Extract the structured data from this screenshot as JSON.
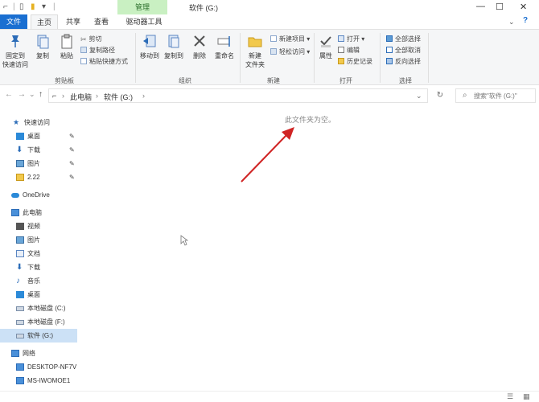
{
  "titlebar": {
    "context_tab": "管理",
    "title": "软件 (G:)",
    "minimize": "—",
    "maximize": "☐",
    "close": "✕"
  },
  "tabs": {
    "file": "文件",
    "home": "主页",
    "share": "共享",
    "view": "查看",
    "drive_tools": "驱动器工具"
  },
  "ribbon": {
    "clipboard": {
      "label": "剪贴板",
      "pin": "固定到\n快速访问",
      "copy": "复制",
      "paste": "粘贴",
      "cut": "剪切",
      "copy_path": "复制路径",
      "paste_shortcut": "粘贴快捷方式"
    },
    "organize": {
      "label": "组织",
      "move_to": "移动到",
      "copy_to": "复制到",
      "delete": "删除",
      "rename": "重命名"
    },
    "new": {
      "label": "新建",
      "new_folder": "新建\n文件夹",
      "new_item": "新建项目 ▾",
      "easy_access": "轻松访问 ▾"
    },
    "open": {
      "label": "打开",
      "properties": "属性",
      "open": "打开 ▾",
      "edit": "编辑",
      "history": "历史记录"
    },
    "select": {
      "label": "选择",
      "select_all": "全部选择",
      "select_none": "全部取消",
      "invert": "反向选择"
    }
  },
  "address": {
    "back": "←",
    "forward": "→",
    "recent": "⌄",
    "up": "↑",
    "crumb_pc": "此电脑",
    "crumb_sep": "›",
    "crumb_drive": "软件 (G:)",
    "dropdown": "⌄",
    "refresh": "↻",
    "search_placeholder": "搜索\"软件 (G:)\""
  },
  "nav": {
    "quick_access": "快速访问",
    "desktop": "桌面",
    "downloads": "下载",
    "pictures": "图片",
    "folder_222": "2.22",
    "onedrive": "OneDrive",
    "this_pc": "此电脑",
    "videos": "视频",
    "pictures2": "图片",
    "documents": "文档",
    "downloads2": "下载",
    "music": "音乐",
    "desktop2": "桌面",
    "local_c": "本地磁盘 (C:)",
    "local_f": "本地磁盘 (F:)",
    "software_g": "软件 (G:)",
    "network": "网络",
    "desktop_host": "DESKTOP-NF7V",
    "ms_host": "MS-IWOMOE1",
    "pin": "✎"
  },
  "content": {
    "empty_message": "此文件夹为空。"
  },
  "colors": {
    "accent": "#1a6fd1",
    "context_tab": "#c9f0c2",
    "selected": "#cce1f6",
    "arrow": "#d02424"
  }
}
